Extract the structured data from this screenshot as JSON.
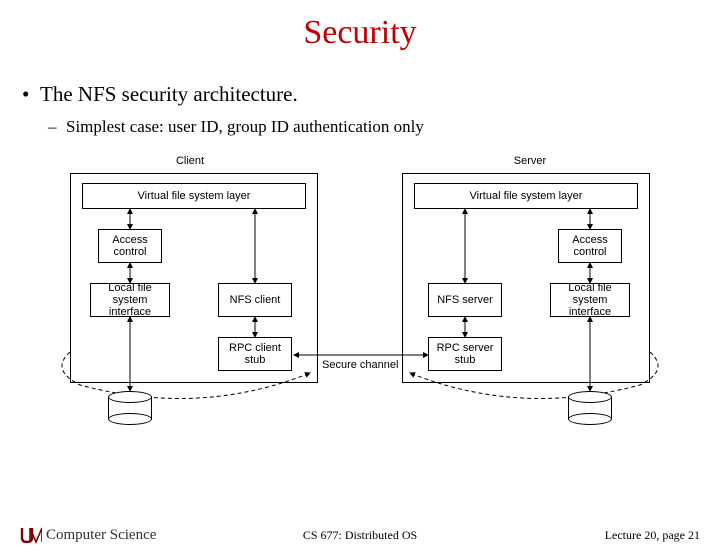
{
  "title": "Security",
  "bullet": "The NFS security architecture.",
  "sub_bullet": "Simplest case: user ID, group ID authentication only",
  "diagram": {
    "client_label": "Client",
    "server_label": "Server",
    "vfs_layer": "Virtual file system layer",
    "access_control": "Access control",
    "local_fs": "Local file system interface",
    "nfs_client": "NFS client",
    "nfs_server": "NFS server",
    "rpc_client": "RPC client stub",
    "rpc_server": "RPC server stub",
    "secure_channel": "Secure channel"
  },
  "footer": {
    "left": "Computer Science",
    "center": "CS 677: Distributed OS",
    "right": "Lecture 20, page 21"
  }
}
